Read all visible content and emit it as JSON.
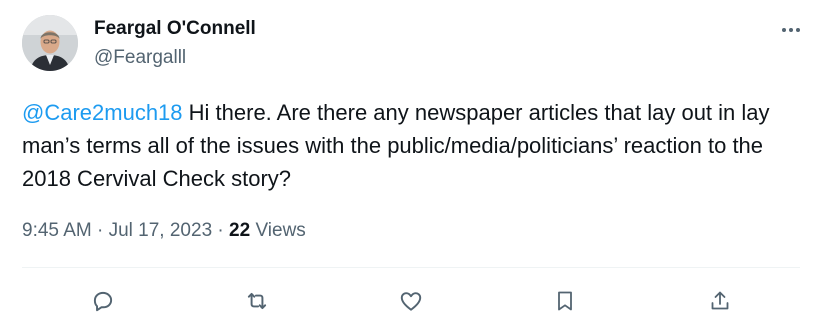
{
  "tweet": {
    "author": {
      "display_name": "Feargal O'Connell",
      "handle": "@Feargalll",
      "avatar_icon": "person-avatar-icon"
    },
    "body": {
      "mention": "@Care2much18",
      "text": " Hi there. Are there any newspaper articles that lay out in lay man’s terms all of the issues with the public/media/politicians’ reaction to the 2018 Cervival Check story?"
    },
    "meta": {
      "time": "9:45 AM",
      "separator1": " · ",
      "date": "Jul 17, 2023",
      "separator2": " · ",
      "views_count": "22",
      "views_label": " Views"
    },
    "actions": [
      {
        "name": "reply",
        "icon": "reply-icon"
      },
      {
        "name": "retweet",
        "icon": "retweet-icon"
      },
      {
        "name": "like",
        "icon": "heart-icon"
      },
      {
        "name": "bookmark",
        "icon": "bookmark-icon"
      },
      {
        "name": "share",
        "icon": "share-icon"
      }
    ],
    "more_icon": "more-icon"
  },
  "colors": {
    "text": "#0f1419",
    "secondary": "#536471",
    "link": "#1d9bf0",
    "divider": "#eff3f4"
  }
}
